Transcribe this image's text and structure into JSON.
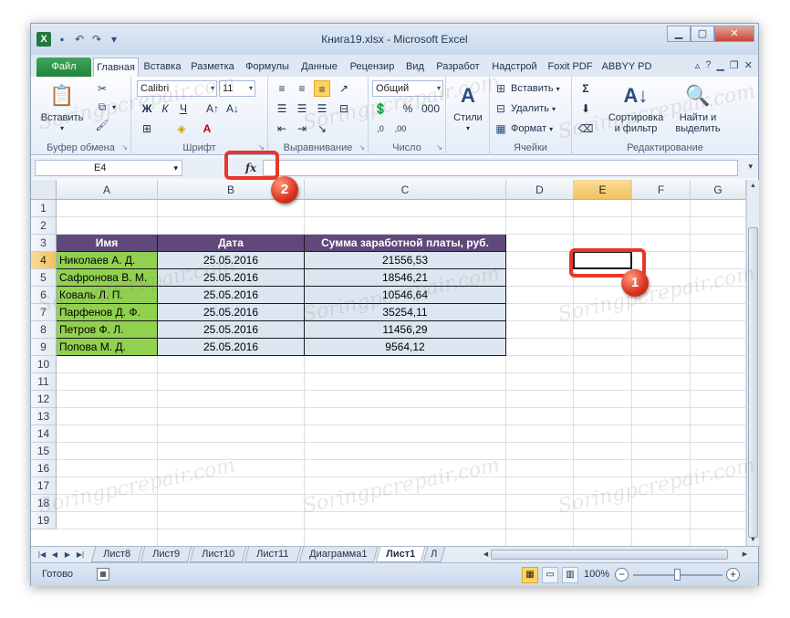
{
  "window": {
    "title": "Книга19.xlsx - Microsoft Excel",
    "app_icon": "excel-logo-icon"
  },
  "tabs": [
    {
      "label": "Файл"
    },
    {
      "label": "Главная"
    },
    {
      "label": "Вставка"
    },
    {
      "label": "Разметка"
    },
    {
      "label": "Формулы"
    },
    {
      "label": "Данные"
    },
    {
      "label": "Рецензир"
    },
    {
      "label": "Вид"
    },
    {
      "label": "Разработ"
    },
    {
      "label": "Надстрой"
    },
    {
      "label": "Foxit PDF"
    },
    {
      "label": "ABBYY PD"
    }
  ],
  "ribbon": {
    "clipboard": {
      "paste": "Вставить",
      "label": "Буфер обмена"
    },
    "font": {
      "name": "Calibri",
      "size": "11",
      "label": "Шрифт"
    },
    "alignment": {
      "label": "Выравнивание"
    },
    "number": {
      "format": "Общий",
      "label": "Число"
    },
    "styles": {
      "button": "Стили"
    },
    "cells": {
      "insert": "Вставить",
      "delete": "Удалить",
      "format": "Формат",
      "label": "Ячейки"
    },
    "editing": {
      "sort_line1": "Сортировка",
      "sort_line2": "и фильтр",
      "find_line1": "Найти и",
      "find_line2": "выделить",
      "label": "Редактирование"
    }
  },
  "formula_bar": {
    "name_box": "E4",
    "fx": "fx",
    "value": ""
  },
  "columns": [
    "A",
    "B",
    "C",
    "D",
    "E",
    "F",
    "G"
  ],
  "rows": [
    "1",
    "2",
    "3",
    "4",
    "5",
    "6",
    "7",
    "8",
    "9",
    "10",
    "11",
    "12",
    "13",
    "14",
    "15",
    "16",
    "17",
    "18",
    "19"
  ],
  "table": {
    "headers": [
      "Имя",
      "Дата",
      "Сумма заработной платы, руб."
    ],
    "rows": [
      {
        "name": "Николаев А. Д.",
        "date": "25.05.2016",
        "amount": "21556,53"
      },
      {
        "name": "Сафронова В. М.",
        "date": "25.05.2016",
        "amount": "18546,21"
      },
      {
        "name": "Коваль Л. П.",
        "date": "25.05.2016",
        "amount": "10546,64"
      },
      {
        "name": "Парфенов Д. Ф.",
        "date": "25.05.2016",
        "amount": "35254,11"
      },
      {
        "name": "Петров Ф. Л.",
        "date": "25.05.2016",
        "amount": "11456,29"
      },
      {
        "name": "Попова М. Д.",
        "date": "25.05.2016",
        "amount": "9564,12"
      }
    ]
  },
  "sheets": [
    "Лист8",
    "Лист9",
    "Лист10",
    "Лист11",
    "Диаграмма1",
    "Лист1",
    "Л"
  ],
  "active_sheet": "Лист1",
  "status": {
    "ready": "Готово",
    "zoom": "100%"
  },
  "annotations": {
    "badge1": "1",
    "badge2": "2"
  },
  "watermark": "Soringpcrepair.com",
  "colors": {
    "header_bg": "#60497a",
    "name_bg": "#92d050",
    "row_bg": "#dce6f1",
    "annotation_red": "#e8362a",
    "file_tab_green": "#2e9a4a"
  }
}
